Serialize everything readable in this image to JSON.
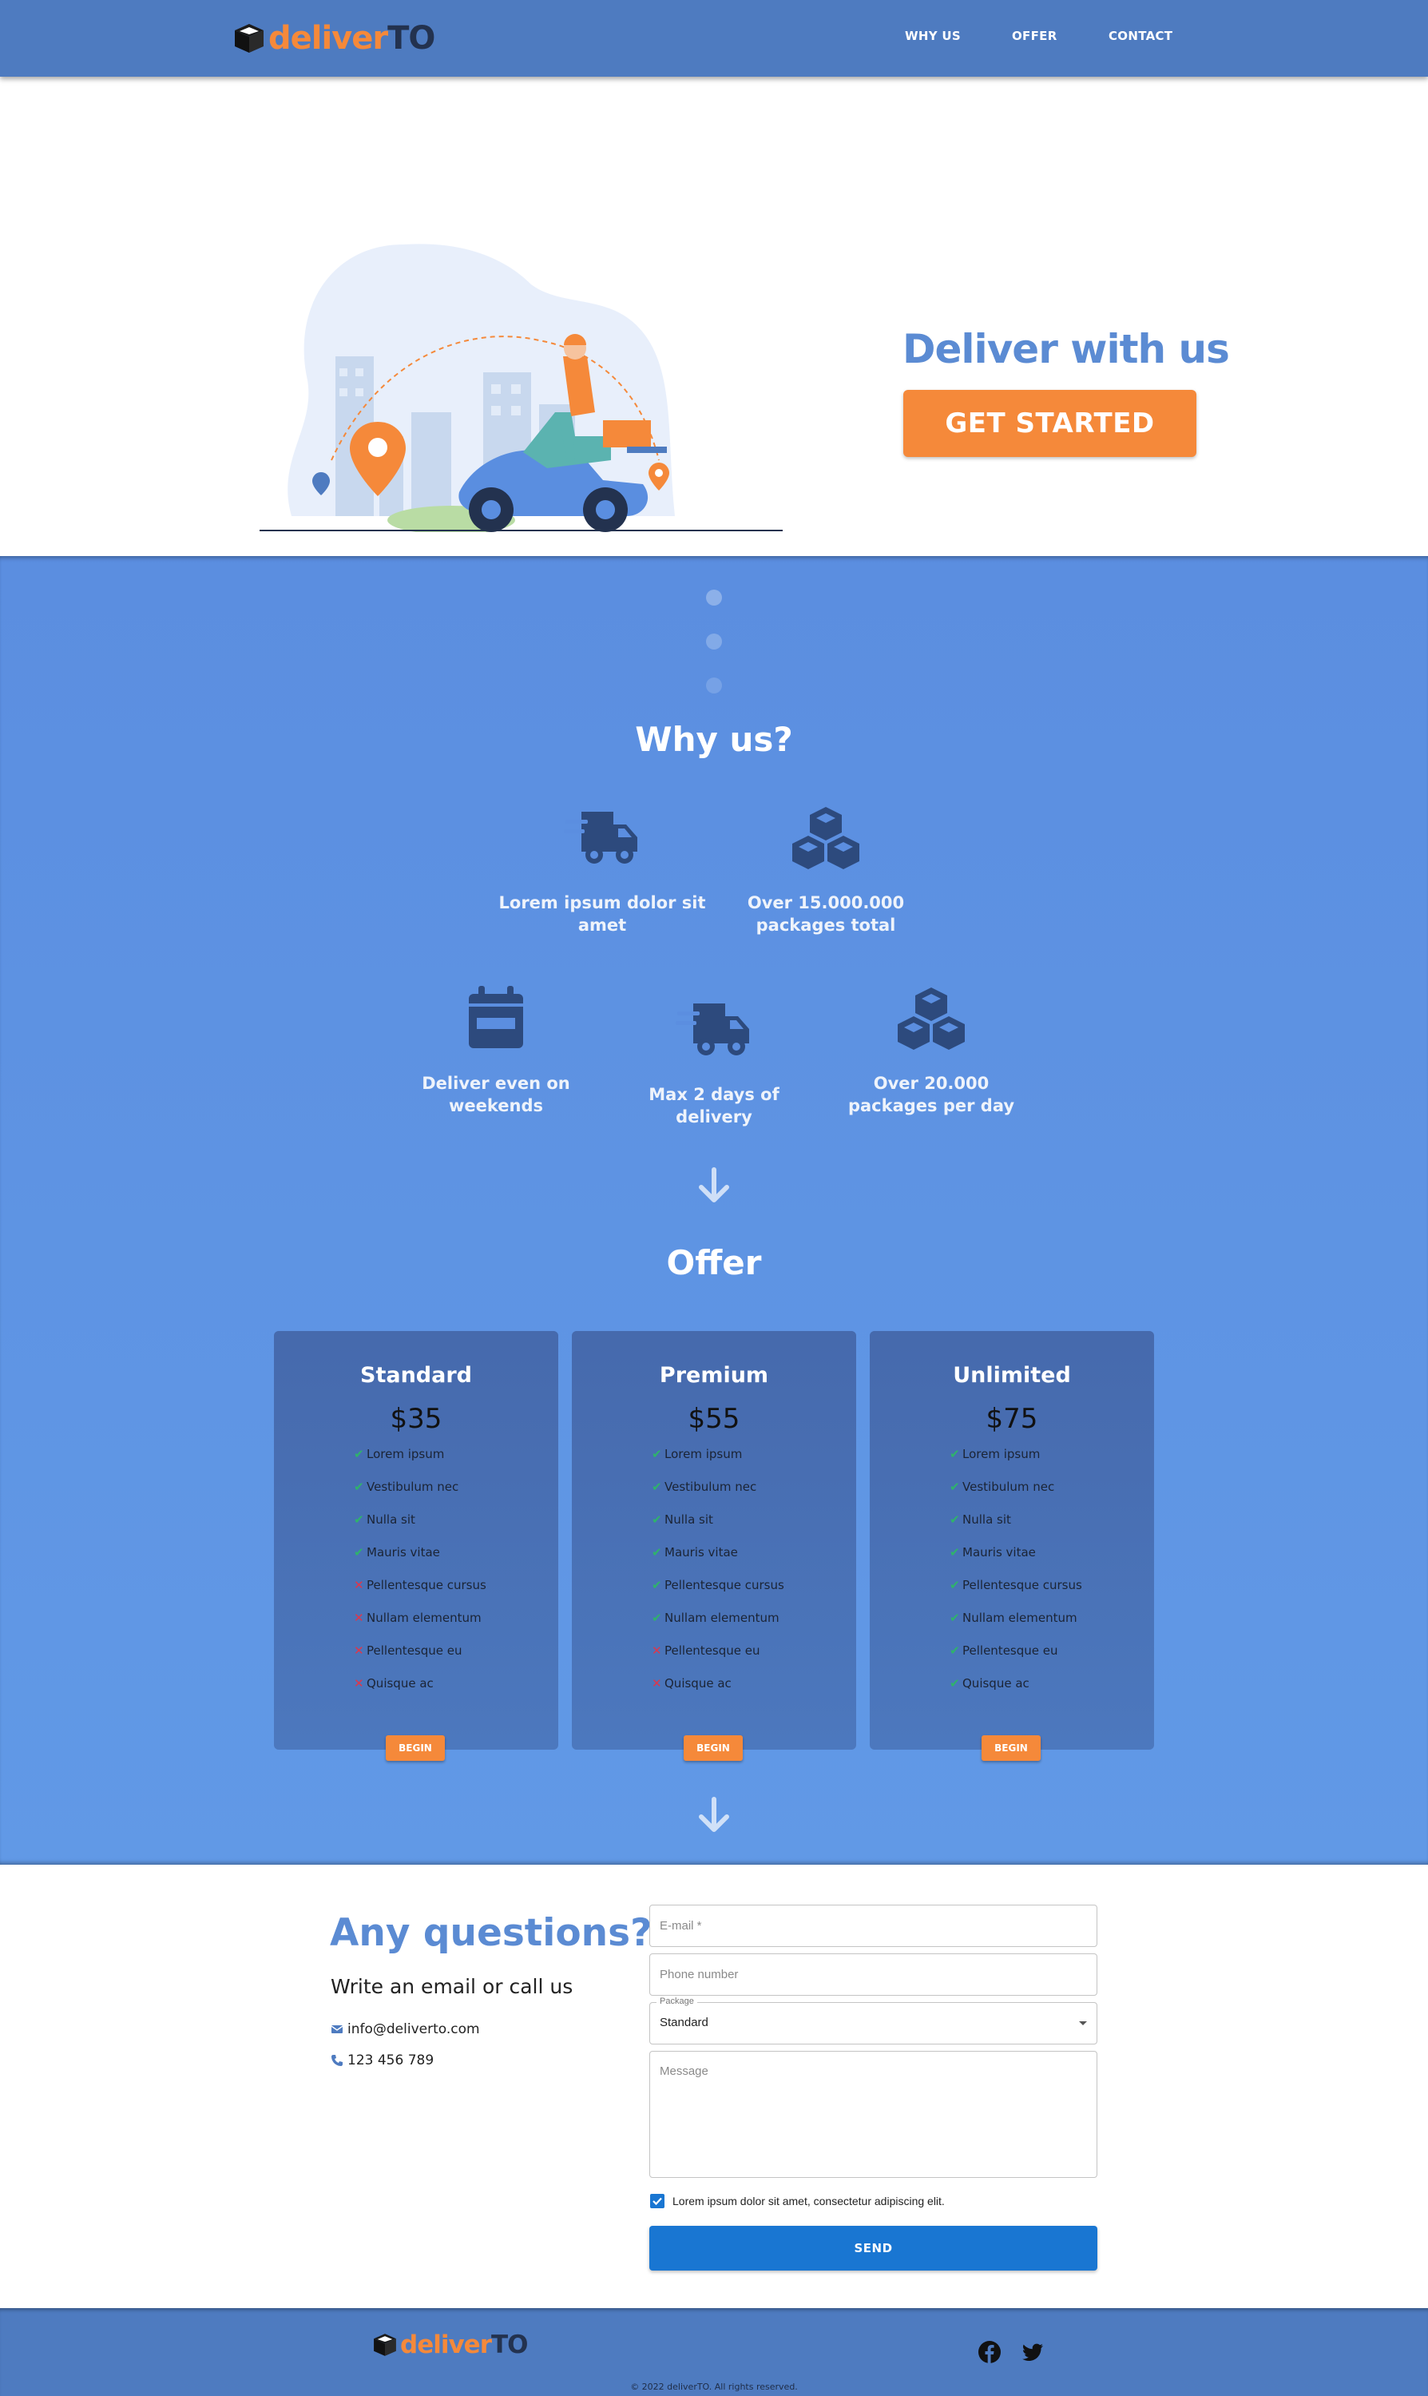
{
  "brand": {
    "part1": "deliver",
    "part2": "TO"
  },
  "nav": {
    "links": [
      "WHY US",
      "OFFER",
      "CONTACT"
    ]
  },
  "hero": {
    "title": "Deliver with us",
    "cta": "GET STARTED"
  },
  "why": {
    "title": "Why us?",
    "features": [
      {
        "icon": "shipping-truck-icon",
        "label": "Lorem ipsum dolor sit amet"
      },
      {
        "icon": "boxes-icon",
        "label": "Over 15.000.000 packages total"
      },
      {
        "icon": "calendar-icon",
        "label": "Deliver even on weekends"
      },
      {
        "icon": "shipping-truck-icon",
        "label": "Max 2 days of delivery"
      },
      {
        "icon": "boxes-icon",
        "label": "Over 20.000 packages per day"
      }
    ]
  },
  "offer": {
    "title": "Offer",
    "button_label": "BEGIN",
    "plans": [
      {
        "name": "Standard",
        "price": "$35",
        "features": [
          {
            "text": "Lorem ipsum",
            "included": true
          },
          {
            "text": "Vestibulum nec",
            "included": true
          },
          {
            "text": "Nulla sit",
            "included": true
          },
          {
            "text": "Mauris vitae",
            "included": true
          },
          {
            "text": "Pellentesque cursus",
            "included": false
          },
          {
            "text": "Nullam elementum",
            "included": false
          },
          {
            "text": "Pellentesque eu",
            "included": false
          },
          {
            "text": "Quisque ac",
            "included": false
          }
        ]
      },
      {
        "name": "Premium",
        "price": "$55",
        "features": [
          {
            "text": "Lorem ipsum",
            "included": true
          },
          {
            "text": "Vestibulum nec",
            "included": true
          },
          {
            "text": "Nulla sit",
            "included": true
          },
          {
            "text": "Mauris vitae",
            "included": true
          },
          {
            "text": "Pellentesque cursus",
            "included": true
          },
          {
            "text": "Nullam elementum",
            "included": true
          },
          {
            "text": "Pellentesque eu",
            "included": false
          },
          {
            "text": "Quisque ac",
            "included": false
          }
        ]
      },
      {
        "name": "Unlimited",
        "price": "$75",
        "features": [
          {
            "text": "Lorem ipsum",
            "included": true
          },
          {
            "text": "Vestibulum nec",
            "included": true
          },
          {
            "text": "Nulla sit",
            "included": true
          },
          {
            "text": "Mauris vitae",
            "included": true
          },
          {
            "text": "Pellentesque cursus",
            "included": true
          },
          {
            "text": "Nullam elementum",
            "included": true
          },
          {
            "text": "Pellentesque eu",
            "included": true
          },
          {
            "text": "Quisque ac",
            "included": true
          }
        ]
      }
    ]
  },
  "contact": {
    "title": "Any questions?",
    "subtitle": "Write an email or call us",
    "email": "info@deliverto.com",
    "phone": "123 456 789",
    "form": {
      "email_placeholder": "E-mail *",
      "phone_placeholder": "Phone number",
      "package_label": "Package",
      "package_value": "Standard",
      "message_placeholder": "Message",
      "consent": "Lorem ipsum dolor sit amet, consectetur adipiscing elit.",
      "send": "SEND"
    }
  },
  "footer": {
    "copyright": "© 2022 deliverTO. All rights reserved."
  },
  "colors": {
    "nav": "#4e7bc0",
    "accent": "#f5893a",
    "blue_section": "#5b8ee0",
    "title_blue": "#5b8bd3",
    "send": "#1976d2"
  }
}
